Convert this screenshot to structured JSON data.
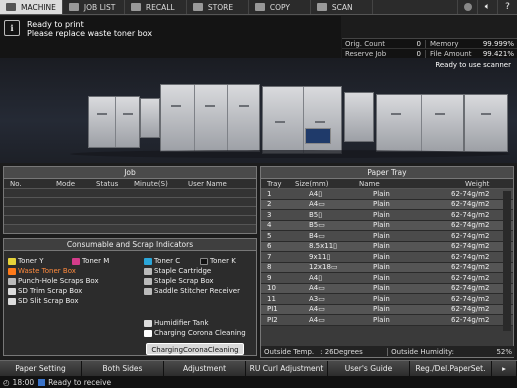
{
  "tabs": [
    {
      "label": "MACHINE",
      "icon": "machine-icon",
      "active": true
    },
    {
      "label": "JOB LIST",
      "icon": "job-list-icon"
    },
    {
      "label": "RECALL",
      "icon": "recall-icon"
    },
    {
      "label": "STORE",
      "icon": "store-icon"
    },
    {
      "label": "COPY",
      "icon": "copy-icon"
    },
    {
      "label": "SCAN",
      "icon": "scan-icon"
    }
  ],
  "message": {
    "line1": "Ready to print",
    "line2": "Please replace waste toner box"
  },
  "counters": {
    "orig_count_label": "Orig. Count",
    "orig_count": "0",
    "memory_label": "Memory",
    "memory": "99.999%",
    "reserve_job_label": "Reserve Job",
    "reserve_job": "0",
    "file_amount_label": "File Amount",
    "file_amount": "99.421%"
  },
  "scanner_status": "Ready to use scanner",
  "job_panel": {
    "title": "Job",
    "columns": [
      "No.",
      "Mode",
      "Status",
      "Minute(S)",
      "User Name"
    ]
  },
  "consumables": {
    "title": "Consumable and Scrap Indicators",
    "items": [
      "Toner Y",
      "Toner M",
      "Toner C",
      "Toner K",
      "Waste Toner Box",
      "Staple Cartridge",
      "Punch-Hole Scraps Box",
      "Staple Scrap Box",
      "SD Trim Scrap Box",
      "Saddle Stitcher Receiver",
      "SD Slit Scrap Box",
      "Humidifier Tank",
      "Charging Corona Cleaning"
    ],
    "button": "ChargingCoronaCleaning"
  },
  "paper_tray": {
    "title": "Paper Tray",
    "columns": [
      "Tray",
      "Size(mm)",
      "Name",
      "Weight"
    ],
    "rows": [
      [
        "1",
        "A4▯",
        "Plain",
        "62-74g/m2"
      ],
      [
        "2",
        "A4▭",
        "Plain",
        "62-74g/m2"
      ],
      [
        "3",
        "B5▯",
        "Plain",
        "62-74g/m2"
      ],
      [
        "4",
        "B5▭",
        "Plain",
        "62-74g/m2"
      ],
      [
        "5",
        "B4▭",
        "Plain",
        "62-74g/m2"
      ],
      [
        "6",
        "8.5x11▯",
        "Plain",
        "62-74g/m2"
      ],
      [
        "7",
        "9x11▯",
        "Plain",
        "62-74g/m2"
      ],
      [
        "8",
        "12x18▭",
        "Plain",
        "62-74g/m2"
      ],
      [
        "9",
        "A4▯",
        "Plain",
        "62-74g/m2"
      ],
      [
        "10",
        "A4▭",
        "Plain",
        "62-74g/m2"
      ],
      [
        "11",
        "A3▭",
        "Plain",
        "62-74g/m2"
      ],
      [
        "PI1",
        "A4▭",
        "Plain",
        "62-74g/m2"
      ],
      [
        "PI2",
        "A4▭",
        "Plain",
        "62-74g/m2"
      ]
    ],
    "outside_temp_label": "Outside Temp.",
    "outside_temp": ": 26Degrees",
    "outside_humidity_label": "Outside Humidity:",
    "outside_humidity": "52%"
  },
  "bottom_buttons": [
    "Paper Setting",
    "Both Sides",
    "Adjustment",
    "RU Curl Adjustment",
    "User's Guide",
    "Reg./Del.PaperSet."
  ],
  "status_bar": {
    "time": "18:00",
    "text": "Ready to receive"
  }
}
